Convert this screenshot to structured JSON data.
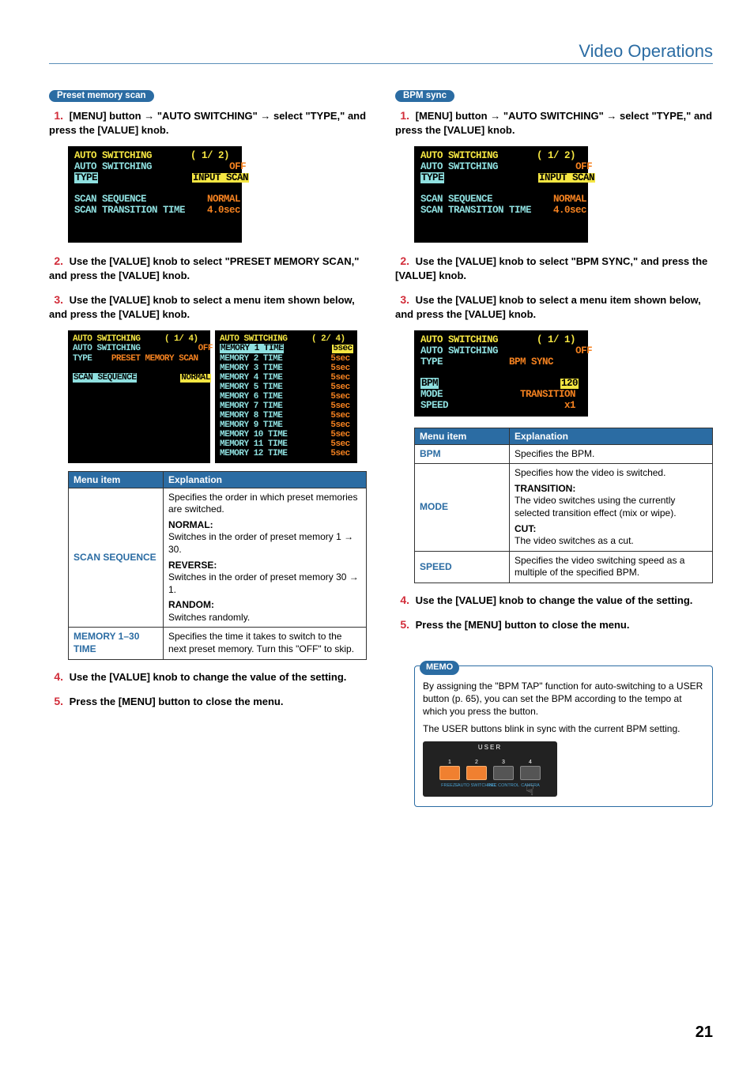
{
  "header": {
    "title": "Video Operations"
  },
  "page_number": "21",
  "left": {
    "pill": "Preset memory scan",
    "step1": {
      "num": "1.",
      "text_a": "[MENU] button ",
      "text_b": " \"AUTO SWITCHING\" ",
      "text_c": " select \"TYPE,\" and press the [VALUE] knob."
    },
    "lcd1": {
      "l1_a": "AUTO SWITCHING",
      "l1_b": "( 1/ 2)",
      "l2_a": "AUTO SWITCHING",
      "l2_b": "OFF",
      "l3_a": "TYPE",
      "l3_b": "INPUT SCAN",
      "l4_a": "SCAN SEQUENCE",
      "l4_b": "NORMAL",
      "l5_a": "SCAN TRANSITION TIME",
      "l5_b": "4.0sec"
    },
    "step2": {
      "num": "2.",
      "text": "Use the [VALUE] knob to select \"PRESET MEMORY SCAN,\" and press the [VALUE] knob."
    },
    "step3": {
      "num": "3.",
      "text": "Use the [VALUE] knob to select a menu item shown below, and press the [VALUE] knob."
    },
    "lcd3a": {
      "l1_a": "AUTO SWITCHING",
      "l1_b": "( 1/ 4)",
      "l2_a": "AUTO SWITCHING",
      "l2_b": "OFF",
      "l3_a": "TYPE",
      "l3_b": "PRESET MEMORY SCAN",
      "l4_a": "SCAN SEQUENCE",
      "l4_b": "NORMAL"
    },
    "lcd3b": {
      "l1_a": "AUTO SWITCHING",
      "l1_b": "( 2/ 4)",
      "rows": [
        {
          "a": "MEMORY 1 TIME",
          "b": "5sec"
        },
        {
          "a": "MEMORY 2 TIME",
          "b": "5sec"
        },
        {
          "a": "MEMORY 3 TIME",
          "b": "5sec"
        },
        {
          "a": "MEMORY 4 TIME",
          "b": "5sec"
        },
        {
          "a": "MEMORY 5 TIME",
          "b": "5sec"
        },
        {
          "a": "MEMORY 6 TIME",
          "b": "5sec"
        },
        {
          "a": "MEMORY 7 TIME",
          "b": "5sec"
        },
        {
          "a": "MEMORY 8 TIME",
          "b": "5sec"
        },
        {
          "a": "MEMORY 9 TIME",
          "b": "5sec"
        },
        {
          "a": "MEMORY 10 TIME",
          "b": "5sec"
        },
        {
          "a": "MEMORY 11 TIME",
          "b": "5sec"
        },
        {
          "a": "MEMORY 12 TIME",
          "b": "5sec"
        }
      ]
    },
    "table": {
      "h1": "Menu item",
      "h2": "Explanation",
      "r1k": "SCAN SEQUENCE",
      "r1_intro": "Specifies the order in which preset memories are switched.",
      "r1_h1": "NORMAL:",
      "r1_t1a": "Switches in the order of preset memory 1",
      "r1_t1b": "30.",
      "r1_h2": "REVERSE:",
      "r1_t2a": "Switches in the order of preset memory 30",
      "r1_t2b": "1.",
      "r1_h3": "RANDOM:",
      "r1_t3": "Switches randomly.",
      "r2k": "MEMORY 1–30 TIME",
      "r2v": "Specifies the time it takes to switch to the next preset memory. Turn this \"OFF\" to skip."
    },
    "step4": {
      "num": "4.",
      "text": "Use the [VALUE] knob to change the value of the setting."
    },
    "step5": {
      "num": "5.",
      "text": "Press the [MENU] button to close the menu."
    }
  },
  "right": {
    "pill": "BPM sync",
    "step1": {
      "num": "1.",
      "text_a": "[MENU] button ",
      "text_b": " \"AUTO SWITCHING\" ",
      "text_c": " select \"TYPE,\" and press the [VALUE] knob."
    },
    "lcd1": {
      "l1_a": "AUTO SWITCHING",
      "l1_b": "( 1/ 2)",
      "l2_a": "AUTO SWITCHING",
      "l2_b": "OFF",
      "l3_a": "TYPE",
      "l3_b": "INPUT SCAN",
      "l4_a": "SCAN SEQUENCE",
      "l4_b": "NORMAL",
      "l5_a": "SCAN TRANSITION TIME",
      "l5_b": "4.0sec"
    },
    "step2": {
      "num": "2.",
      "text": "Use the [VALUE] knob to select \"BPM SYNC,\" and press the [VALUE] knob."
    },
    "step3": {
      "num": "3.",
      "text": "Use the [VALUE] knob to select a menu item shown below, and press the [VALUE] knob."
    },
    "lcd3": {
      "l1_a": "AUTO SWITCHING",
      "l1_b": "( 1/ 1)",
      "l2_a": "AUTO SWITCHING",
      "l2_b": "OFF",
      "l3_a": "TYPE",
      "l3_b": "BPM SYNC",
      "l4_a": "BPM",
      "l4_b": "120",
      "l5_a": "MODE",
      "l5_b": "TRANSITION",
      "l6_a": "SPEED",
      "l6_b": "x1"
    },
    "table": {
      "h1": "Menu item",
      "h2": "Explanation",
      "r1k": "BPM",
      "r1v": "Specifies the BPM.",
      "r2k": "MODE",
      "r2_intro": "Specifies how the video is switched.",
      "r2_h1": "TRANSITION:",
      "r2_t1": "The video switches using the currently selected transition effect (mix or wipe).",
      "r2_h2": "CUT:",
      "r2_t2": "The video switches as a cut.",
      "r3k": "SPEED",
      "r3v": "Specifies the video switching speed as a multiple of the specified BPM."
    },
    "step4": {
      "num": "4.",
      "text": "Use the [VALUE] knob to change the value of the setting."
    },
    "step5": {
      "num": "5.",
      "text": "Press the [MENU] button to close the menu."
    },
    "memo": {
      "label": "MEMO",
      "p1": "By assigning the \"BPM TAP\" function for auto-switching to a USER button (p. 65), you can set the BPM according to the tempo at which you press the button.",
      "p2": "The USER buttons blink in sync with the current BPM setting.",
      "user_label": "USER",
      "b1": "1",
      "b2": "2",
      "b3": "3",
      "b4": "4",
      "s1": "FREEZE",
      "s2": "AUTO SWITCHING",
      "s3": "REC CONTROL",
      "s4": "CAMERA"
    }
  }
}
